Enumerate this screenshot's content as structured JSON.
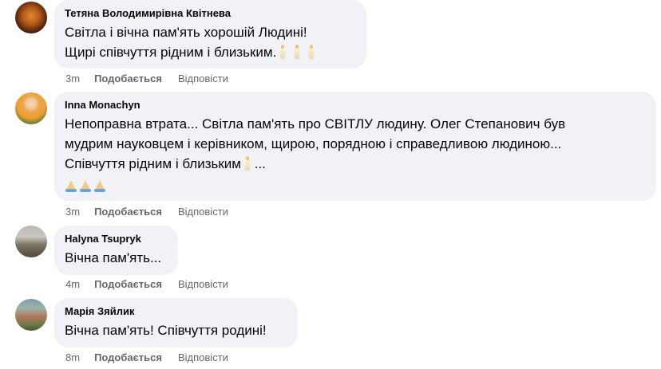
{
  "comments": [
    {
      "author": "Тетяна Володимирівна Квітнева",
      "lines": [
        "Світла і вічна пам'ять хорошій Людині!",
        "Щирі співчуття рідним і близьким."
      ],
      "emoji": "candle-icon x3",
      "time": "3m",
      "like": "Подобається",
      "reply": "Відповісти"
    },
    {
      "author": "Inna Monachyn",
      "lines": [
        "Непоправна втрата... Світла пам'ять про СВІТЛУ людину. Олег Степанович був",
        "мудрим науковцем і керівником, щирою, порядною і справедливою людиною...",
        "Співчуття рідним і близьким",
        "..."
      ],
      "emoji": "candle-icon, pray-icon x3",
      "time": "3m",
      "like": "Подобається",
      "reply": "Відповісти"
    },
    {
      "author": "Halyna Tsupryk",
      "lines": [
        "Вічна пам'ять..."
      ],
      "time": "4m",
      "like": "Подобається",
      "reply": "Відповісти"
    },
    {
      "author": "Марія Зяйлик",
      "lines": [
        "Вічна пам'ять! Співчуття родині!"
      ],
      "time": "8m",
      "like": "Подобається",
      "reply": "Відповісти"
    }
  ]
}
